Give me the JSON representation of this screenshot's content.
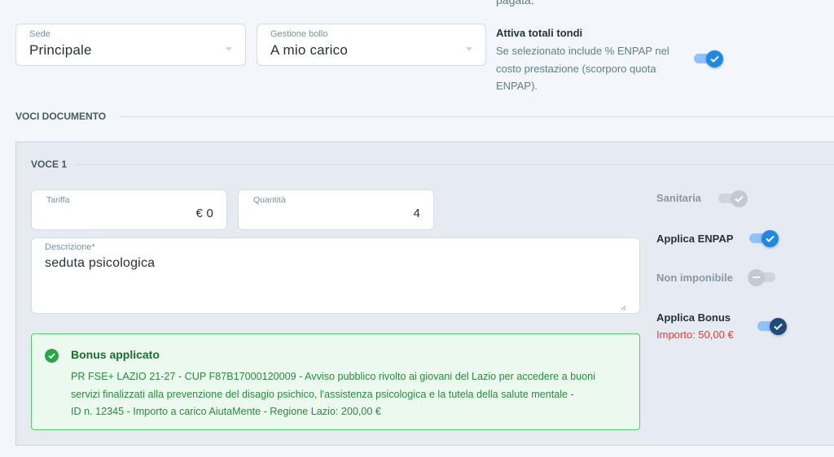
{
  "top": {
    "cut_text": "pagata."
  },
  "sede": {
    "label": "Sede",
    "value": "Principale"
  },
  "gestione_bollo": {
    "label": "Gestione bollo",
    "value": "A mio carico"
  },
  "totali_tondi": {
    "title": "Attiva totali tondi",
    "description_lines": [
      "Se selezionato include % ENPAP nel",
      "costo prestazione (scorporo quota",
      "ENPAP)."
    ],
    "enabled": true
  },
  "voci_documento": {
    "title": "VOCI DOCUMENTO"
  },
  "voce": {
    "title": "VOCE 1",
    "tariffa": {
      "label": "Tariffa",
      "value": "€ 0"
    },
    "quantita": {
      "label": "Quantità",
      "value": "4"
    },
    "descrizione": {
      "label": "Descrizione*",
      "value": "seduta psicologica"
    },
    "sanitaria": {
      "label": "Sanitaria",
      "enabled": true,
      "disabled": true
    },
    "applica_enpap": {
      "label": "Applica ENPAP",
      "enabled": true
    },
    "non_imponibile": {
      "label": "Non imponibile",
      "enabled": false,
      "disabled": true
    },
    "applica_bonus": {
      "label": "Applica Bonus",
      "importo": "Importo: 50,00 €",
      "enabled": true
    },
    "bonus": {
      "title": "Bonus applicato",
      "lines": [
        "PR FSE+ LAZIO 21-27 - CUP F87B17000120009 - Avviso pubblico rivolto ai giovani del Lazio per accedere a buoni",
        "servizi finalizzati alla prevenzione del disagio psichico, l'assistenza psicologica e la tutela della salute mentale -",
        "ID n. 12345 - Importo a carico AiutaMente - Regione Lazio: 200,00 €"
      ]
    }
  },
  "colors": {
    "accent": "#1e88e5",
    "success": "#28a745",
    "danger": "#e53935"
  }
}
